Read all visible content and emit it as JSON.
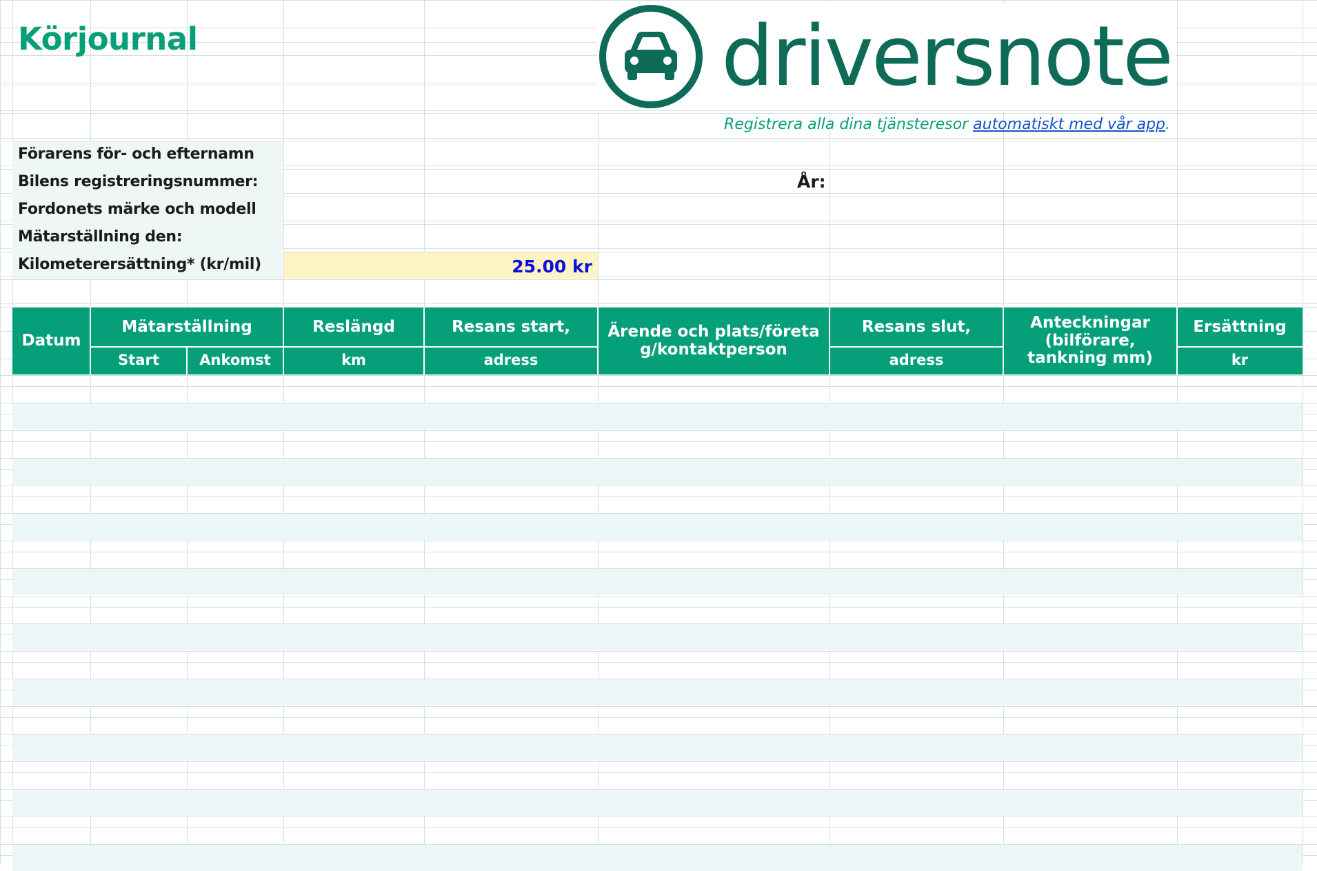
{
  "sheet": {
    "title": "Körjournal",
    "brand": {
      "name": "driversnote",
      "color": "#0e6b58",
      "icon": "car-in-circle-icon"
    },
    "tagline": {
      "text": "Registrera alla dina tjänsteresor ",
      "link": "automatiskt med vår app",
      "suffix": "."
    },
    "info_labels": [
      "Förarens för- och efternamn",
      "Bilens registreringsnummer:",
      "Fordonets märke och modell",
      "Mätarställning den:",
      "Kilometerersättning* (kr/mil)"
    ],
    "year_label": "År:",
    "rate_value": "25.00 kr",
    "headers": {
      "datum": "Datum",
      "matarstallning": "Mätarställning",
      "start": "Start",
      "ankomst": "Ankomst",
      "reslangd": "Reslängd",
      "reslangd_unit": "km",
      "resans_start": "Resans start,",
      "resans_start_sub": "adress",
      "arende": "Ärende och plats/företag/kontaktperson",
      "resans_slut": "Resans slut,",
      "resans_slut_sub": "adress",
      "anteckningar": "Anteckningar (bilförare, tankning mm)",
      "ersattning": "Ersättning",
      "ersattning_unit": "kr"
    },
    "colors": {
      "accent": "#05a07a",
      "title": "#079f79",
      "row_band": "#ecf6f6",
      "info_bg": "#eef6f6",
      "rate_bg": "#fdf3c4",
      "rate_text": "#0b10d9",
      "link": "#1155cc"
    }
  }
}
